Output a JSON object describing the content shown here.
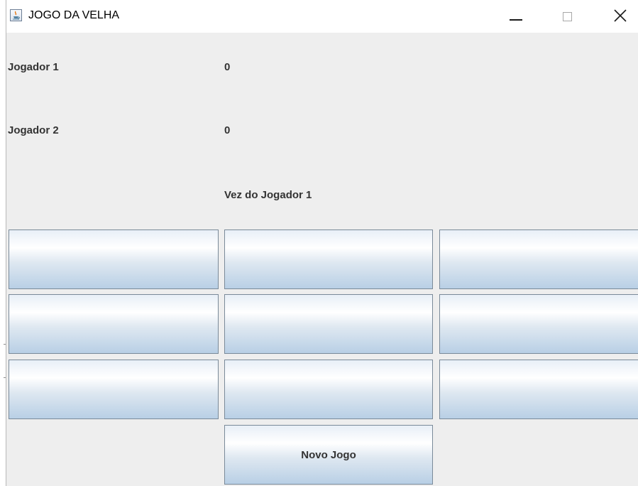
{
  "window": {
    "title": "JOGO DA VELHA",
    "icon": "java-icon",
    "controls": [
      "minimize-icon",
      "maximize-icon",
      "close-icon"
    ]
  },
  "scoreboard": {
    "player1_label": "Jogador 1",
    "player1_score": "0",
    "player2_label": "Jogador 2",
    "player2_score": "0",
    "turn_status": "Vez do Jogador 1"
  },
  "board": {
    "cells": [
      [
        "",
        "",
        ""
      ],
      [
        "",
        "",
        ""
      ],
      [
        "",
        "",
        ""
      ]
    ]
  },
  "actions": {
    "new_game_label": "Novo Jogo"
  },
  "colors": {
    "background": "#eeeeee",
    "label_text": "#333333",
    "button_border": "#7a8a99",
    "button_gradient_bottom": "#b8cfe5"
  }
}
